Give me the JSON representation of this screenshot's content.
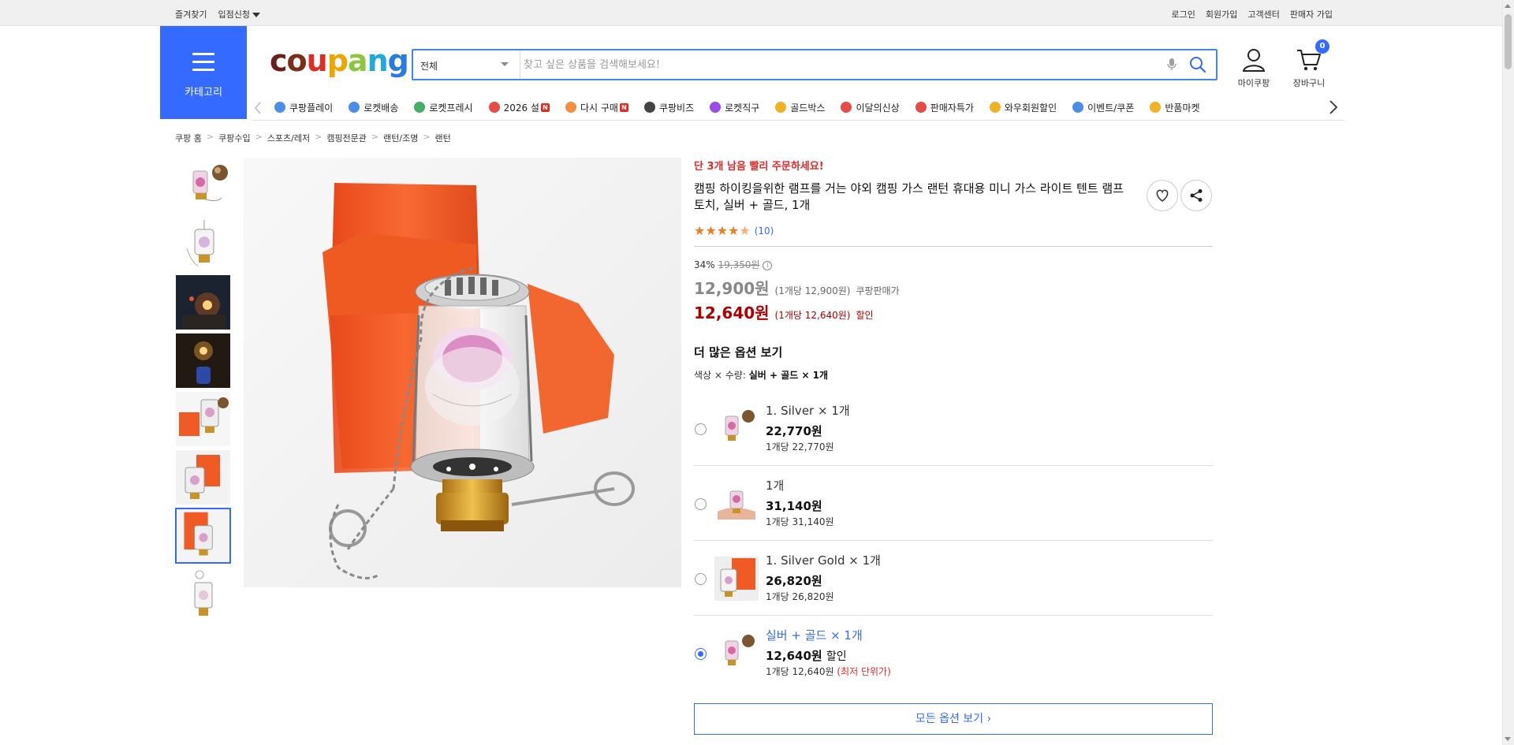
{
  "topbar": {
    "left": [
      "즐겨찾기",
      "입점신청"
    ],
    "right": [
      "로그인",
      "회원가입",
      "고객센터",
      "판매자 가입"
    ]
  },
  "header": {
    "category_label": "카테고리",
    "logo_text": "coupang",
    "search_category": "전체",
    "search_placeholder": "찾고 싶은 상품을 검색해보세요!",
    "mycoupang_label": "마이쿠팡",
    "cart_label": "장바구니",
    "cart_count": "0"
  },
  "menu": [
    {
      "label": "쿠팡플레이",
      "icon": "play-icon",
      "badge": ""
    },
    {
      "label": "로켓배송",
      "icon": "rocket-icon",
      "badge": ""
    },
    {
      "label": "로켓프레시",
      "icon": "rocket-fresh-icon",
      "badge": ""
    },
    {
      "label": "2026 설",
      "icon": "gift-icon",
      "badge": "N"
    },
    {
      "label": "다시 구매",
      "icon": "home-icon",
      "badge": "N"
    },
    {
      "label": "쿠팡비즈",
      "icon": "biz-icon",
      "badge": ""
    },
    {
      "label": "로켓직구",
      "icon": "globe-icon",
      "badge": ""
    },
    {
      "label": "골드박스",
      "icon": "goldbox-icon",
      "badge": ""
    },
    {
      "label": "이달의신상",
      "icon": "new-bag-icon",
      "badge": ""
    },
    {
      "label": "판매자특가",
      "icon": "discount-icon",
      "badge": ""
    },
    {
      "label": "와우회원할인",
      "icon": "wow-icon",
      "badge": ""
    },
    {
      "label": "이벤트/쿠폰",
      "icon": "coupon-icon",
      "badge": ""
    },
    {
      "label": "반품마켓",
      "icon": "market-icon",
      "badge": ""
    }
  ],
  "breadcrumb": [
    "쿠팡 홈",
    "쿠팡수입",
    "스포츠/레저",
    "캠핑전문관",
    "랜턴/조명",
    "랜턴"
  ],
  "product": {
    "low_stock": "단 3개 남음 빨리 주문하세요!",
    "title": "캠핑 하이킹을위한 램프를 거는 야외 캠핑 가스 랜턴 휴대용 미니 가스 라이트 텐트 램프 토치, 실버 + 골드, 1개",
    "rating": 4.5,
    "review_count": "(10)",
    "discount_rate": "34%",
    "original_price": "19,350원",
    "price": "12,900원",
    "price_unit": "(1개당 12,900원)",
    "price_label": "쿠팡판매가",
    "sale_price": "12,640원",
    "sale_unit": "(1개당 12,640원)",
    "sale_label": "할인",
    "more_options_title": "더 많은 옵션 보기",
    "selection_label": "색상 × 수량: ",
    "selection_value": "실버 + 골드 × 1개",
    "all_options_button": "모든 옵션 보기"
  },
  "options": [
    {
      "name": "1. Silver × 1개",
      "price": "22,770원",
      "tag": "",
      "unit": "1개당 22,770원",
      "unit_note": "",
      "selected": false
    },
    {
      "name": "1개",
      "price": "31,140원",
      "tag": "",
      "unit": "1개당 31,140원",
      "unit_note": "",
      "selected": false
    },
    {
      "name": "1. Silver Gold × 1개",
      "price": "26,820원",
      "tag": "",
      "unit": "1개당 26,820원",
      "unit_note": "",
      "selected": false
    },
    {
      "name": "실버 + 골드 × 1개",
      "price": "12,640원",
      "tag": "할인",
      "unit": "1개당 12,640원",
      "unit_note": "(최저 단위가)",
      "selected": true
    }
  ],
  "colors": {
    "accent": "#346aff",
    "sale_red": "#ae0000",
    "alert_red": "#e02b27",
    "star": "#f47a1f"
  }
}
